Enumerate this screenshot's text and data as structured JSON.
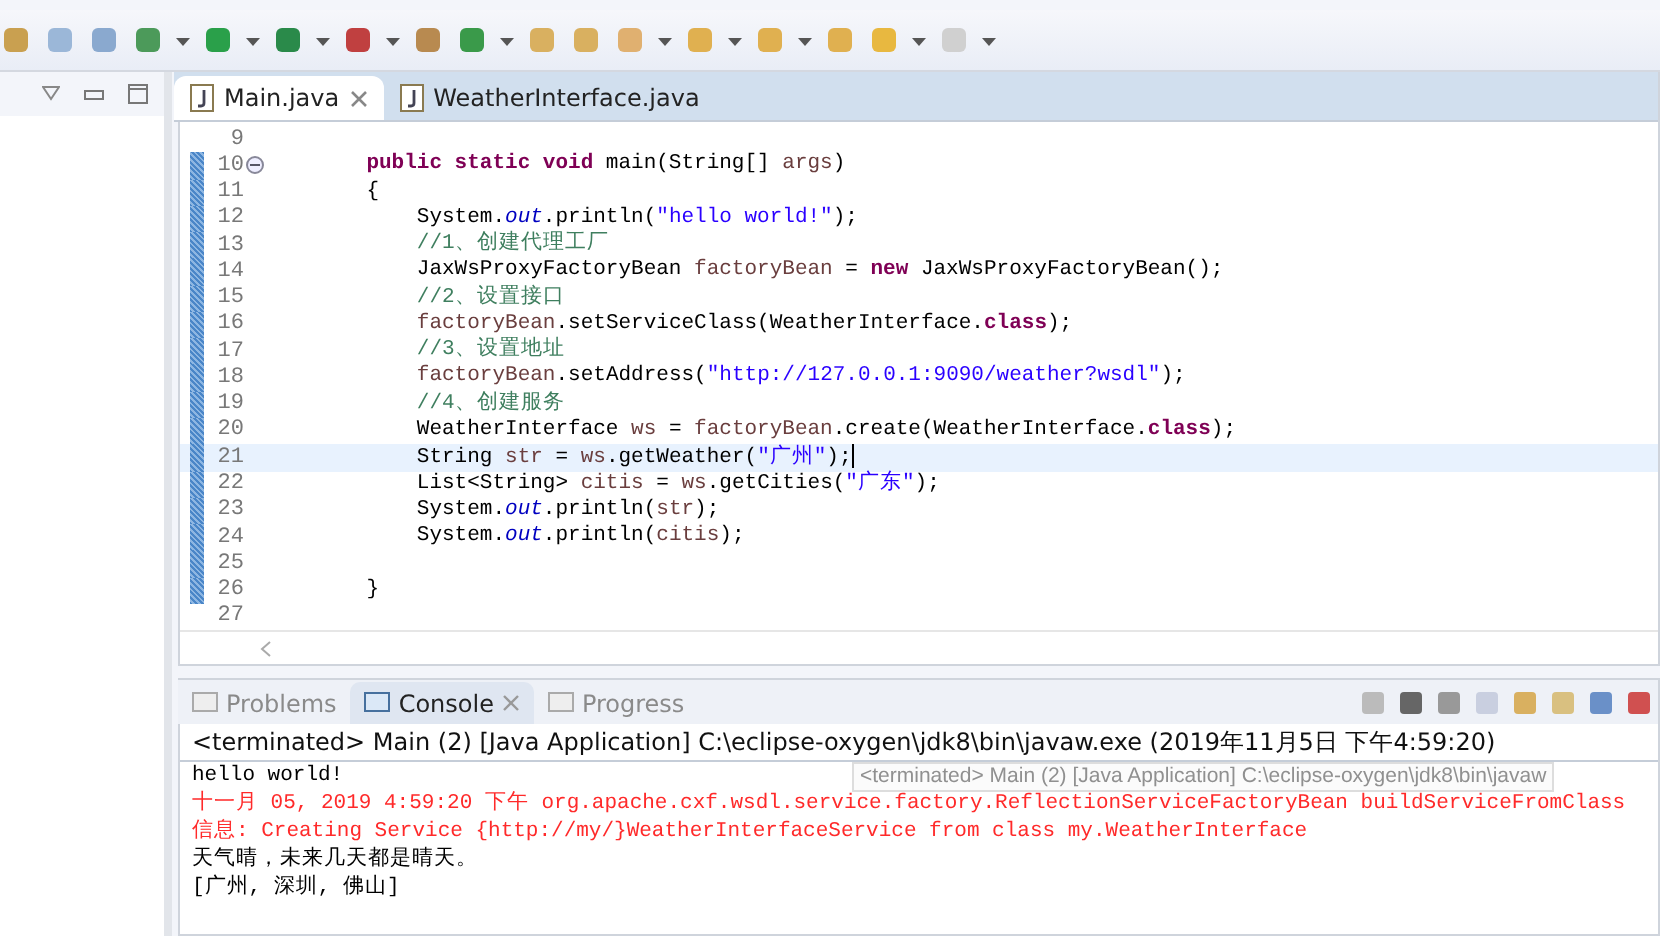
{
  "editor_tabs": [
    {
      "label": "Main.java",
      "selected": true
    },
    {
      "label": "WeatherInterface.java",
      "selected": false
    }
  ],
  "code_lines": [
    {
      "number": "9",
      "changed": false,
      "current": false,
      "folded": false
    },
    {
      "number": "10",
      "changed": true,
      "current": false,
      "folded": true,
      "tokens": [
        {
          "kind": "keyword",
          "text": "    public static void"
        },
        {
          "kind": "plain",
          "text": " main(String[] "
        },
        {
          "kind": "param",
          "text": "args"
        },
        {
          "kind": "plain",
          "text": ")"
        }
      ]
    },
    {
      "number": "11",
      "changed": true,
      "current": false,
      "folded": false,
      "tokens": [
        {
          "kind": "plain",
          "text": "    {"
        }
      ]
    },
    {
      "number": "12",
      "changed": true,
      "current": false,
      "folded": false,
      "tokens": [
        {
          "kind": "plain",
          "text": "        System."
        },
        {
          "kind": "field",
          "text": "out"
        },
        {
          "kind": "plain",
          "text": ".println("
        },
        {
          "kind": "string",
          "text": "\"hello world!\""
        },
        {
          "kind": "plain",
          "text": ");"
        }
      ]
    },
    {
      "number": "13",
      "changed": true,
      "current": false,
      "folded": false,
      "tokens": [
        {
          "kind": "comment",
          "text": "        //1、创建代理工厂"
        }
      ]
    },
    {
      "number": "14",
      "changed": true,
      "current": false,
      "folded": false,
      "tokens": [
        {
          "kind": "plain",
          "text": "        JaxWsProxyFactoryBean "
        },
        {
          "kind": "local",
          "text": "factoryBean"
        },
        {
          "kind": "plain",
          "text": " = "
        },
        {
          "kind": "keyword",
          "text": "new"
        },
        {
          "kind": "plain",
          "text": " JaxWsProxyFactoryBean();"
        }
      ]
    },
    {
      "number": "15",
      "changed": true,
      "current": false,
      "folded": false,
      "tokens": [
        {
          "kind": "comment",
          "text": "        //2、设置接口"
        }
      ]
    },
    {
      "number": "16",
      "changed": true,
      "current": false,
      "folded": false,
      "tokens": [
        {
          "kind": "local",
          "text": "        factoryBean"
        },
        {
          "kind": "plain",
          "text": ".setServiceClass(WeatherInterface."
        },
        {
          "kind": "keyword",
          "text": "class"
        },
        {
          "kind": "plain",
          "text": ");"
        }
      ]
    },
    {
      "number": "17",
      "changed": true,
      "current": false,
      "folded": false,
      "tokens": [
        {
          "kind": "comment",
          "text": "        //3、设置地址"
        }
      ]
    },
    {
      "number": "18",
      "changed": true,
      "current": false,
      "folded": false,
      "tokens": [
        {
          "kind": "local",
          "text": "        factoryBean"
        },
        {
          "kind": "plain",
          "text": ".setAddress("
        },
        {
          "kind": "string",
          "text": "\"http://127.0.0.1:9090/weather?wsdl\""
        },
        {
          "kind": "plain",
          "text": ");"
        }
      ]
    },
    {
      "number": "19",
      "changed": true,
      "current": false,
      "folded": false,
      "tokens": [
        {
          "kind": "comment",
          "text": "        //4、创建服务"
        }
      ]
    },
    {
      "number": "20",
      "changed": true,
      "current": false,
      "folded": false,
      "tokens": [
        {
          "kind": "plain",
          "text": "        WeatherInterface "
        },
        {
          "kind": "local",
          "text": "ws"
        },
        {
          "kind": "plain",
          "text": " = "
        },
        {
          "kind": "local",
          "text": "factoryBean"
        },
        {
          "kind": "plain",
          "text": ".create(WeatherInterface."
        },
        {
          "kind": "keyword",
          "text": "class"
        },
        {
          "kind": "plain",
          "text": ");"
        }
      ]
    },
    {
      "number": "21",
      "changed": true,
      "current": true,
      "folded": false,
      "tokens": [
        {
          "kind": "plain",
          "text": "        String "
        },
        {
          "kind": "local",
          "text": "str"
        },
        {
          "kind": "plain",
          "text": " = "
        },
        {
          "kind": "local",
          "text": "ws"
        },
        {
          "kind": "plain",
          "text": ".getWeather("
        },
        {
          "kind": "string",
          "text": "\"广州\""
        },
        {
          "kind": "plain",
          "text": ");"
        }
      ]
    },
    {
      "number": "22",
      "changed": true,
      "current": false,
      "folded": false,
      "tokens": [
        {
          "kind": "plain",
          "text": "        List<String> "
        },
        {
          "kind": "local",
          "text": "citis"
        },
        {
          "kind": "plain",
          "text": " = "
        },
        {
          "kind": "local",
          "text": "ws"
        },
        {
          "kind": "plain",
          "text": ".getCities("
        },
        {
          "kind": "string",
          "text": "\"广东\""
        },
        {
          "kind": "plain",
          "text": ");"
        }
      ]
    },
    {
      "number": "23",
      "changed": true,
      "current": false,
      "folded": false,
      "tokens": [
        {
          "kind": "plain",
          "text": "        System."
        },
        {
          "kind": "field",
          "text": "out"
        },
        {
          "kind": "plain",
          "text": ".println("
        },
        {
          "kind": "local",
          "text": "str"
        },
        {
          "kind": "plain",
          "text": ");"
        }
      ]
    },
    {
      "number": "24",
      "changed": true,
      "current": false,
      "folded": false,
      "tokens": [
        {
          "kind": "plain",
          "text": "        System."
        },
        {
          "kind": "field",
          "text": "out"
        },
        {
          "kind": "plain",
          "text": ".println("
        },
        {
          "kind": "local",
          "text": "citis"
        },
        {
          "kind": "plain",
          "text": ");"
        }
      ]
    },
    {
      "number": "25",
      "changed": true,
      "current": false,
      "folded": false
    },
    {
      "number": "26",
      "changed": true,
      "current": false,
      "folded": false,
      "tokens": [
        {
          "kind": "plain",
          "text": "    }"
        }
      ]
    },
    {
      "number": "27",
      "changed": false,
      "current": false,
      "folded": false
    }
  ],
  "console_tabs": [
    {
      "label": "Problems",
      "selected": false
    },
    {
      "label": "Console",
      "selected": true
    },
    {
      "label": "Progress",
      "selected": false
    }
  ],
  "console_description": "<terminated> Main (2) [Java Application] C:\\eclipse-oxygen\\jdk8\\bin\\javaw.exe (2019年11月5日 下午4:59:20)",
  "console_lines": [
    {
      "kind": "out",
      "text": "hello world!"
    },
    {
      "kind": "err",
      "text": "十一月 05, 2019 4:59:20 下午 org.apache.cxf.wsdl.service.factory.ReflectionServiceFactoryBean buildServiceFromClass"
    },
    {
      "kind": "err",
      "text": "信息: Creating Service {http://my/}WeatherInterfaceService from class my.WeatherInterface"
    },
    {
      "kind": "out",
      "text": "天气晴，未来几天都是晴天。"
    },
    {
      "kind": "out",
      "text": "[广州, 深圳, 佛山]"
    }
  ],
  "tooltip": "<terminated> Main (2) [Java Application] C:\\eclipse-oxygen\\jdk8\\bin\\javaw"
}
